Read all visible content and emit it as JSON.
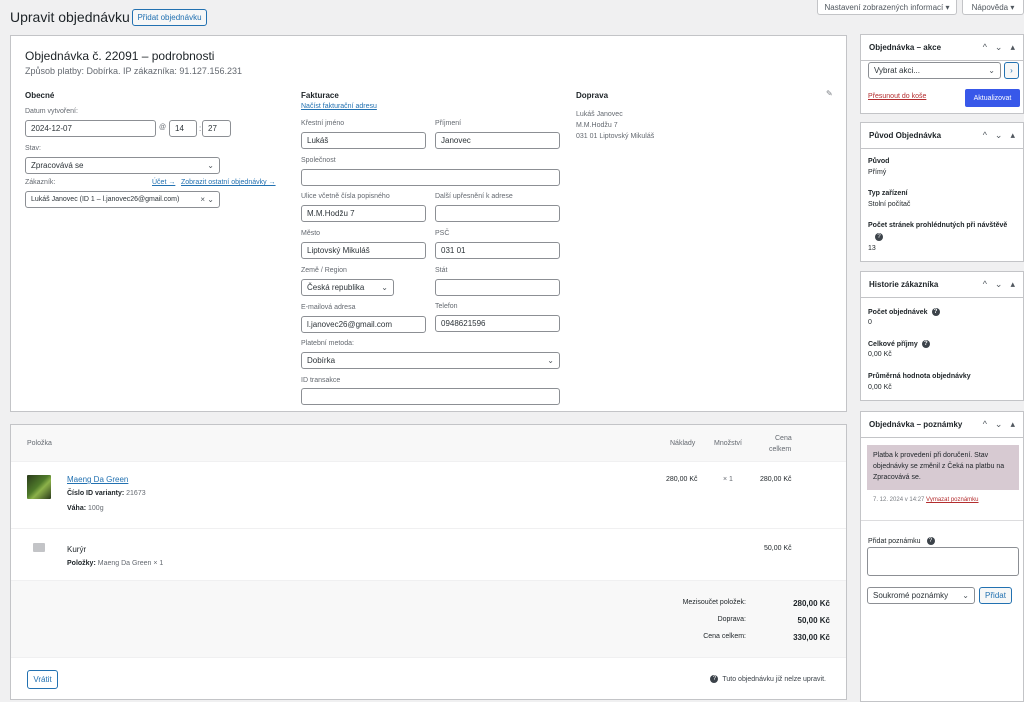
{
  "header": {
    "title": "Upravit objednávku",
    "add_order": "Přidat objednávku",
    "screen_options": "Nastavení zobrazených informací ▾",
    "help": "Nápověda ▾"
  },
  "order": {
    "heading": "Objednávka č. 22091 – podrobnosti",
    "subheading": "Způsob platby: Dobírka. IP zákazníka: 91.127.156.231"
  },
  "general": {
    "title": "Obecné",
    "date_label": "Datum vytvoření:",
    "date": "2024-12-07",
    "at": "@",
    "hour": "14",
    "colon": ":",
    "minute": "27",
    "status_label": "Stav:",
    "status": "Zpracovává se",
    "customer_label": "Zákazník:",
    "account_link": "Účet →",
    "other_orders_link": "Zobrazit ostatní objednávky →",
    "customer": "Lukáš Janovec (ID 1 – l.janovec26@gmail.com)"
  },
  "billing": {
    "title": "Fakturace",
    "load_link": "Načíst fakturační adresu",
    "first_name_label": "Křestní jméno",
    "first_name": "Lukáš",
    "last_name_label": "Příjmení",
    "last_name": "Janovec",
    "company_label": "Společnost",
    "company": "",
    "street_label": "Ulice včetně čísla popisného",
    "street": "M.M.Hodžu 7",
    "address2_label": "Další upřesnění k adrese",
    "address2": "",
    "city_label": "Město",
    "city": "Liptovský Mikuláš",
    "zip_label": "PSČ",
    "zip": "031 01",
    "country_label": "Země / Region",
    "country": "Česká republika",
    "state_label": "Stát",
    "state": "",
    "email_label": "E-mailová adresa",
    "email": "l.janovec26@gmail.com",
    "phone_label": "Telefon",
    "phone": "0948621596",
    "payment_label": "Platební metoda:",
    "payment": "Dobírka",
    "txn_label": "ID transakce",
    "txn": ""
  },
  "shipping": {
    "title": "Doprava",
    "line1": "Lukáš Janovec",
    "line2": "M.M.Hodžu 7",
    "line3": "031 01 Liptovský Mikuláš"
  },
  "items": {
    "col_item": "Položka",
    "col_cost": "Náklady",
    "col_qty": "Množství",
    "col_total_1": "Cena",
    "col_total_2": "celkem",
    "product_name": "Maeng Da Green",
    "variant_label": "Číslo ID varianty:",
    "variant_id": "21673",
    "weight_label": "Váha:",
    "weight": "100g",
    "cost": "280,00 Kč",
    "qty": "× 1",
    "total": "280,00 Kč",
    "shipping_name": "Kurýr",
    "shipping_items_label": "Položky:",
    "shipping_items": "Maeng Da Green × 1",
    "shipping_total": "50,00 Kč",
    "subtotal_label": "Mezisoučet položek:",
    "subtotal": "280,00 Kč",
    "ship_label": "Doprava:",
    "ship": "50,00 Kč",
    "grand_label": "Cena celkem:",
    "grand": "330,00 Kč",
    "refund_button": "Vrátit",
    "notice": "Tuto objednávku již nelze upravit."
  },
  "sidebar": {
    "actions": {
      "title": "Objednávka – akce",
      "select": "Vybrat akci...",
      "trash": "Přesunout do koše",
      "update": "Aktualizovat"
    },
    "origin": {
      "title": "Původ Objednávka",
      "origin_label": "Původ",
      "origin_value": "Přímý",
      "device_label": "Typ zařízení",
      "device_value": "Stolní počítač",
      "pages_label": "Počet stránek prohlédnutých při návštěvě",
      "pages_value": "13"
    },
    "history": {
      "title": "Historie zákazníka",
      "orders_label": "Počet objednávek",
      "orders_value": "0",
      "revenue_label": "Celkové příjmy",
      "revenue_value": "0,00 Kč",
      "avg_label": "Průměrná hodnota objednávky",
      "avg_value": "0,00 Kč"
    },
    "notes": {
      "title": "Objednávka – poznámky",
      "note_text": "Platba k provedení při doručení. Stav objednávky se změnil z Čeká na platbu na Zpracovává se.",
      "note_meta": "7. 12. 2024 v 14:27",
      "delete_link": "Vymazat poznámku",
      "add_label": "Přidat poznámku",
      "note_type": "Soukromé poznámky",
      "add_button": "Přidat"
    }
  },
  "colors": {
    "accent": "#2271b1",
    "primary_button": "#3858e9",
    "note_bg": "#d7cad2",
    "danger": "#b32d2e"
  }
}
